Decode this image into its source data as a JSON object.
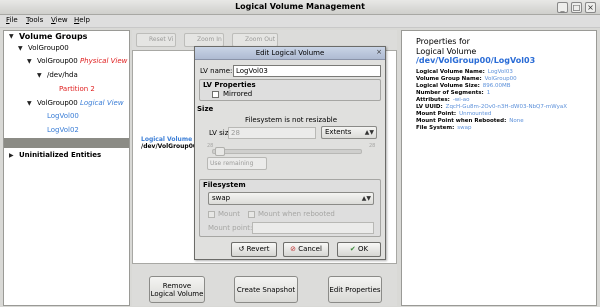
{
  "window": {
    "title": "Logical Volume Management"
  },
  "menu": {
    "items": [
      {
        "key": "F",
        "rest": "ile"
      },
      {
        "key": "T",
        "rest": "ools"
      },
      {
        "key": "V",
        "rest": "iew"
      },
      {
        "key": "H",
        "rest": "elp"
      }
    ]
  },
  "tree": {
    "volume_groups": "Volume Groups",
    "vg": "VolGroup00",
    "physical_vg": "VolGroup00",
    "physical_view": "Physical View",
    "pv": "/dev/hda",
    "partition": "Partition 2",
    "logical_vg": "VolGroup00",
    "logical_view": "Logical View",
    "lv1": "LogVol00",
    "lv2": "LogVol02",
    "uninitialized": "Uninitialized Entities"
  },
  "toolbar": {
    "reset": "Reset Vi",
    "zoom_in": "Zoom In",
    "zoom_out": "Zoom Out"
  },
  "canvas": {
    "lv_label_1": "Logical Volume",
    "lv_label_2": "/dev/VolGroup00/lo"
  },
  "actions": {
    "remove_line1": "Remove",
    "remove_line2": "Logical Volume",
    "snapshot": "Create Snapshot",
    "edit": "Edit Properties"
  },
  "properties": {
    "heading1": "Properties for",
    "heading2": "Logical Volume",
    "heading3": "/dev/VolGroup00/LogVol03",
    "rows": [
      {
        "key": "Logical Volume Name:",
        "value": "LogVol03"
      },
      {
        "key": "Volume Group Name:",
        "value": "VolGroup00"
      },
      {
        "key": "Logical Volume Size:",
        "value": "896.00MB"
      },
      {
        "key": "Number of Segments:",
        "value": "1"
      },
      {
        "key": "Attributes:",
        "value": "-wi-ao"
      },
      {
        "key": "LV UUID:",
        "value": "ZqcH-Gu8m-2Ov0-n3H-dW03-NbQ7-mWyaX"
      },
      {
        "key": "Mount Point:",
        "value": "Unmounted"
      },
      {
        "key": "Mount Point when Rebooted:",
        "value": "None"
      },
      {
        "key": "File System:",
        "value": "swap"
      }
    ]
  },
  "dialog": {
    "title": "Edit Logical Volume",
    "lv_name_label": "LV name:",
    "lv_name_value": "LogVol03",
    "lv_properties": "LV Properties",
    "mirrored": "Mirrored",
    "size_title": "Size",
    "not_resizable": "Filesystem is not resizable",
    "lv_size_label": "LV size",
    "lv_size_value": "28",
    "unit": "Extents",
    "slider_min": "28",
    "slider_max": "28",
    "use_remaining": "Use remaining",
    "filesystem_title": "Filesystem",
    "filesystem_value": "swap",
    "mount": "Mount",
    "mount_reboot": "Mount when rebooted",
    "mount_point_label": "Mount point:",
    "revert": "Revert",
    "cancel": "Cancel",
    "ok": "OK"
  }
}
